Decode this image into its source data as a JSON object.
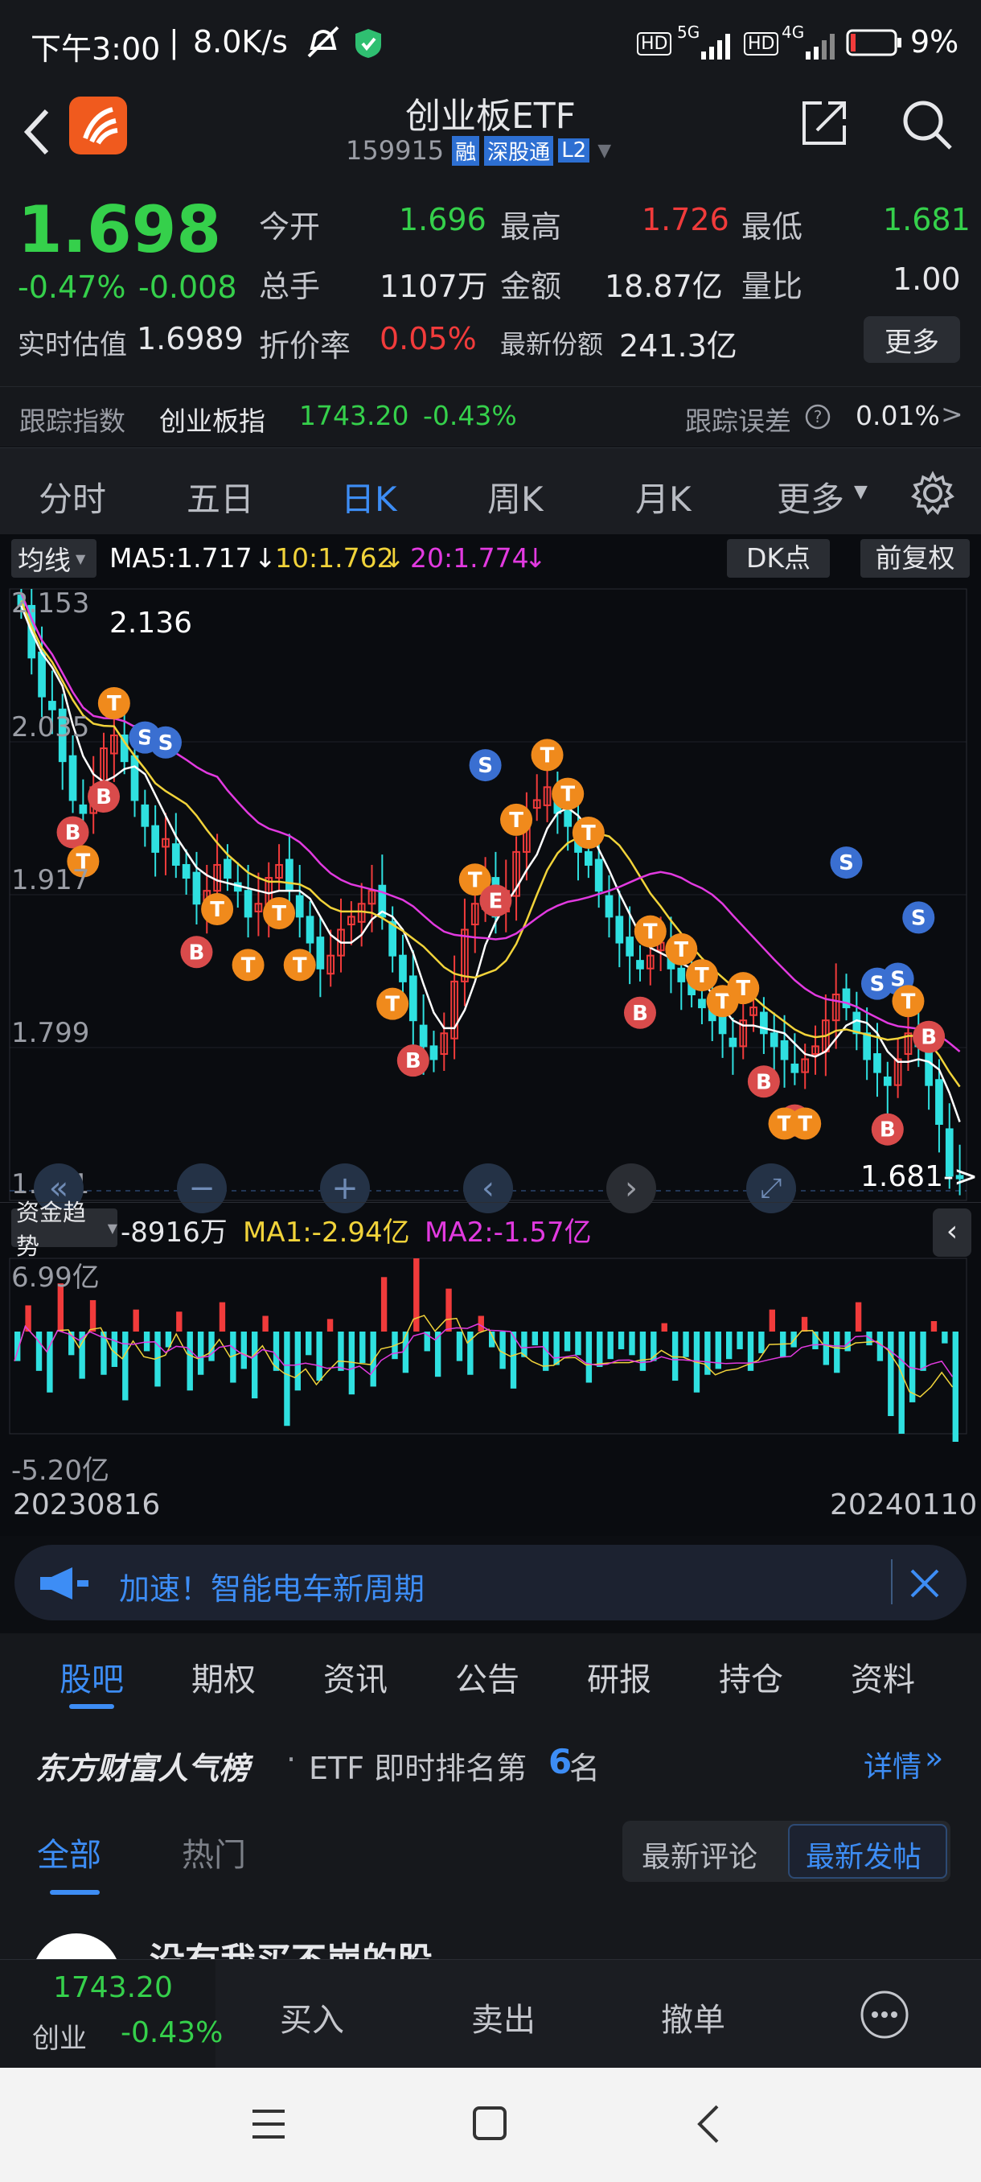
{
  "status_bar": {
    "time": "下午3:00",
    "speed": "8.0K/s",
    "net1": "5G",
    "net2": "4G",
    "hd": "HD",
    "battery": "9%"
  },
  "header": {
    "title": "创业板ETF",
    "code": "159915",
    "badges": [
      "融",
      "深股通",
      "L2"
    ]
  },
  "quote": {
    "price": "1.698",
    "change_pct": "-0.47%",
    "change": "-0.008",
    "open_label": "今开",
    "open": "1.696",
    "high_label": "最高",
    "high": "1.726",
    "low_label": "最低",
    "low": "1.681",
    "volume_label": "总手",
    "volume": "1107万",
    "amount_label": "金额",
    "amount": "18.87亿",
    "ratio_label": "量比",
    "ratio": "1.00",
    "iopv_label": "实时估值",
    "iopv": "1.6989",
    "premium_label": "折价率",
    "premium": "0.05%",
    "shares_label": "最新份额",
    "shares": "241.3亿",
    "more_button": "更多"
  },
  "tracking": {
    "index_label": "跟踪指数",
    "index_name": "创业板指",
    "index_value": "1743.20",
    "index_change": "-0.43%",
    "error_label": "跟踪误差",
    "error_value": "0.01%",
    "arrow": ">"
  },
  "period_tabs": [
    "分时",
    "五日",
    "日K",
    "周K",
    "月K",
    "更多"
  ],
  "active_tab": "日K",
  "chart": {
    "indicator": "均线",
    "ma5": "MA5:1.717",
    "ma10": "10:1.762",
    "ma20": "20:1.774",
    "dk_button": "DK点",
    "adjust_button": "前复权",
    "price_ticks": [
      "2.153",
      "2.035",
      "1.917",
      "1.799",
      "1.681"
    ],
    "max_label": "2.136",
    "min_label": "1.681->",
    "markers": {
      "b": "B",
      "s": "S",
      "t": "T",
      "e": "E"
    },
    "flow_label": "资金趋势",
    "flow_value": "-8916万",
    "flow_ma1": "MA1:-2.94亿",
    "flow_ma2": "MA2:-1.57亿",
    "flow_top": "6.99亿",
    "flow_bottom": "-5.20亿",
    "date_start": "20230816",
    "date_end": "20240110",
    "colors": {
      "up": "#f13b3b",
      "down": "#2fe0e0",
      "ma5": "#ffffff",
      "ma10": "#f1d33a",
      "ma20": "#e23ae0",
      "buy": "#d94b4b",
      "sell": "#3a6fd1",
      "t": "#f08a1c"
    }
  },
  "chart_data": {
    "type": "candlestick",
    "y_range": [
      1.681,
      2.153
    ],
    "closes": [
      2.14,
      2.1,
      2.07,
      2.06,
      2.02,
      1.99,
      1.98,
      2.0,
      2.03,
      2.04,
      2.02,
      1.99,
      1.97,
      1.95,
      1.96,
      1.94,
      1.93,
      1.91,
      1.92,
      1.94,
      1.93,
      1.92,
      1.9,
      1.91,
      1.93,
      1.94,
      1.92,
      1.9,
      1.88,
      1.86,
      1.87,
      1.89,
      1.9,
      1.91,
      1.92,
      1.9,
      1.87,
      1.85,
      1.82,
      1.8,
      1.79,
      1.81,
      1.85,
      1.89,
      1.91,
      1.93,
      1.9,
      1.92,
      1.95,
      1.98,
      1.99,
      2.0,
      1.98,
      1.97,
      1.95,
      1.94,
      1.92,
      1.9,
      1.88,
      1.87,
      1.86,
      1.87,
      1.88,
      1.86,
      1.85,
      1.84,
      1.83,
      1.82,
      1.81,
      1.8,
      1.82,
      1.83,
      1.81,
      1.8,
      1.79,
      1.78,
      1.79,
      1.8,
      1.82,
      1.84,
      1.83,
      1.81,
      1.79,
      1.78,
      1.77,
      1.79,
      1.81,
      1.8,
      1.77,
      1.74,
      1.7,
      1.698
    ],
    "fund_flow": [
      -1.5,
      2.5,
      -2.0,
      -3.1,
      4.6,
      -1.2,
      -2.4,
      3.0,
      -2.2,
      -1.8,
      -3.5,
      2.1,
      -1.0,
      -2.8,
      -0.8,
      1.9,
      -3.0,
      -2.2,
      -1.5,
      2.8,
      -2.6,
      -1.9,
      -3.4,
      1.5,
      -2.0,
      -4.8,
      -3.0,
      -1.2,
      -2.5,
      1.2,
      -2.0,
      -3.2,
      -1.6,
      -2.8,
      5.2,
      -1.4,
      -2.1,
      6.99,
      -1.0,
      -2.3,
      4.1,
      -1.5,
      -2.2,
      1.5,
      -0.8,
      -1.9,
      -2.9,
      -1.3,
      -0.7,
      -2.0,
      -1.7,
      -1.0,
      -1.2,
      -2.6,
      -1.8,
      -1.4,
      -0.9,
      -1.2,
      -2.0,
      -1.5,
      0.8,
      -2.5,
      -1.3,
      -3.1,
      -2.2,
      -1.9,
      -1.4,
      -0.9,
      -2.0,
      -1.1,
      2.1,
      -1.3,
      -0.8,
      1.4,
      -0.9,
      -1.7,
      -2.1,
      -1.0,
      2.8,
      -0.7,
      -1.5,
      -4.3,
      -5.2,
      -3.6,
      -2.0,
      1.0,
      -0.6,
      -8.916
    ]
  },
  "banner": {
    "text": "加速！智能电车新周期"
  },
  "sub_tabs": [
    "股吧",
    "期权",
    "资讯",
    "公告",
    "研报",
    "持仓",
    "资料"
  ],
  "active_sub_tab": "股吧",
  "rank": {
    "brand": "东方财富人气榜",
    "text_pre": "ETF 即时排名第",
    "rank_num": "6",
    "text_post": "名",
    "detail": "详情"
  },
  "filter": {
    "tabs": [
      "全部",
      "热门"
    ],
    "sort": [
      "最新评论",
      "最新发帖"
    ]
  },
  "post": {
    "title": "没有我买不崩的股"
  },
  "bottom": {
    "index_value": "1743.20",
    "index_name": "创业",
    "index_change": "-0.43%",
    "buy": "买入",
    "sell": "卖出",
    "cancel": "撤单"
  }
}
